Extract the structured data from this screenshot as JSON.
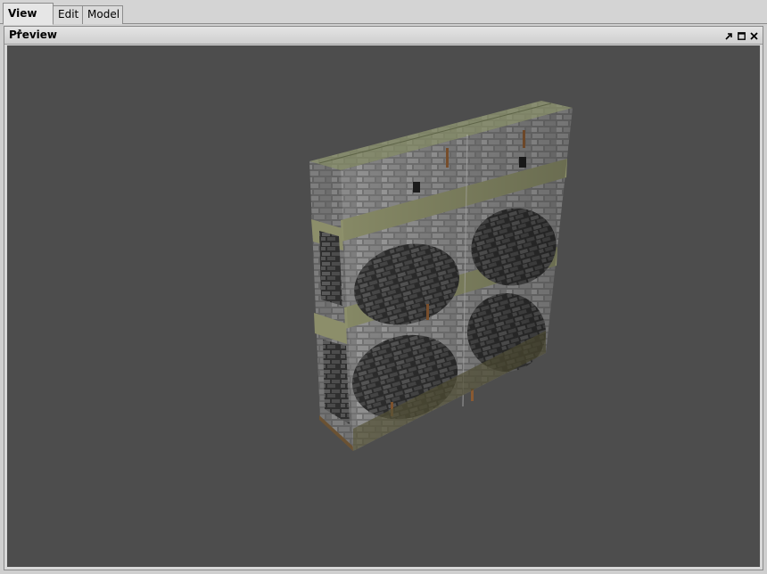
{
  "tabs": [
    {
      "label": "View",
      "active": true
    },
    {
      "label": "Edit",
      "active": false
    },
    {
      "label": "Model",
      "active": false
    }
  ],
  "panel": {
    "title": "Preview",
    "controls": [
      "pin-icon",
      "maximize-icon",
      "close-icon"
    ]
  },
  "viewport": {
    "background": "#4d4d4d",
    "model": "stone-brick-wall"
  },
  "colors": {
    "tabstrip": "#d4d4d4",
    "panel_header": "#d8d8d8",
    "viewport_bg": "#4d4d4d"
  }
}
